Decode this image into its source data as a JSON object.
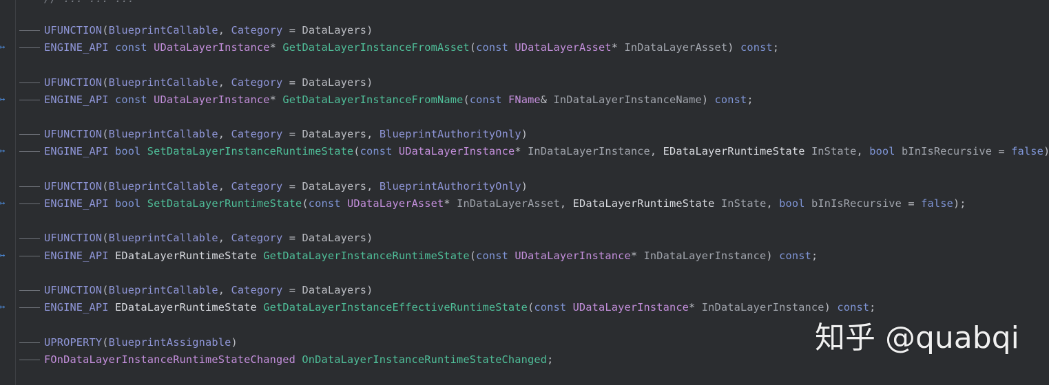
{
  "editor": {
    "top_partial_line": "// ... ... ...",
    "lines": [
      {
        "indent": true,
        "impl_icon": false,
        "tokens": [
          {
            "t": "UFUNCTION",
            "c": "macro"
          },
          {
            "t": "(",
            "c": "punct"
          },
          {
            "t": "BlueprintCallable",
            "c": "macro"
          },
          {
            "t": ", ",
            "c": "punct"
          },
          {
            "t": "Category",
            "c": "macro"
          },
          {
            "t": " = ",
            "c": "punct"
          },
          {
            "t": "DataLayers",
            "c": "ident"
          },
          {
            "t": ")",
            "c": "punct"
          }
        ]
      },
      {
        "indent": true,
        "impl_icon": true,
        "tokens": [
          {
            "t": "ENGINE_API ",
            "c": "macro"
          },
          {
            "t": "const ",
            "c": "kw"
          },
          {
            "t": "UDataLayerInstance",
            "c": "type"
          },
          {
            "t": "* ",
            "c": "punct"
          },
          {
            "t": "GetDataLayerInstanceFromAsset",
            "c": "func"
          },
          {
            "t": "(",
            "c": "punct"
          },
          {
            "t": "const ",
            "c": "kw"
          },
          {
            "t": "UDataLayerAsset",
            "c": "type"
          },
          {
            "t": "* ",
            "c": "punct"
          },
          {
            "t": "InDataLayerAsset",
            "c": "param"
          },
          {
            "t": ") ",
            "c": "punct"
          },
          {
            "t": "const",
            "c": "kw"
          },
          {
            "t": ";",
            "c": "punct"
          }
        ]
      },
      {
        "blank": true
      },
      {
        "indent": true,
        "impl_icon": false,
        "tokens": [
          {
            "t": "UFUNCTION",
            "c": "macro"
          },
          {
            "t": "(",
            "c": "punct"
          },
          {
            "t": "BlueprintCallable",
            "c": "macro"
          },
          {
            "t": ", ",
            "c": "punct"
          },
          {
            "t": "Category",
            "c": "macro"
          },
          {
            "t": " = ",
            "c": "punct"
          },
          {
            "t": "DataLayers",
            "c": "ident"
          },
          {
            "t": ")",
            "c": "punct"
          }
        ]
      },
      {
        "indent": true,
        "impl_icon": true,
        "tokens": [
          {
            "t": "ENGINE_API ",
            "c": "macro"
          },
          {
            "t": "const ",
            "c": "kw"
          },
          {
            "t": "UDataLayerInstance",
            "c": "type"
          },
          {
            "t": "* ",
            "c": "punct"
          },
          {
            "t": "GetDataLayerInstanceFromName",
            "c": "func"
          },
          {
            "t": "(",
            "c": "punct"
          },
          {
            "t": "const ",
            "c": "kw"
          },
          {
            "t": "FName",
            "c": "type"
          },
          {
            "t": "& ",
            "c": "punct"
          },
          {
            "t": "InDataLayerInstanceName",
            "c": "param"
          },
          {
            "t": ") ",
            "c": "punct"
          },
          {
            "t": "const",
            "c": "kw"
          },
          {
            "t": ";",
            "c": "punct"
          }
        ]
      },
      {
        "blank": true
      },
      {
        "indent": true,
        "impl_icon": false,
        "tokens": [
          {
            "t": "UFUNCTION",
            "c": "macro"
          },
          {
            "t": "(",
            "c": "punct"
          },
          {
            "t": "BlueprintCallable",
            "c": "macro"
          },
          {
            "t": ", ",
            "c": "punct"
          },
          {
            "t": "Category",
            "c": "macro"
          },
          {
            "t": " = ",
            "c": "punct"
          },
          {
            "t": "DataLayers",
            "c": "ident"
          },
          {
            "t": ", ",
            "c": "punct"
          },
          {
            "t": "BlueprintAuthorityOnly",
            "c": "macro"
          },
          {
            "t": ")",
            "c": "punct"
          }
        ]
      },
      {
        "indent": true,
        "impl_icon": true,
        "tokens": [
          {
            "t": "ENGINE_API ",
            "c": "macro"
          },
          {
            "t": "bool ",
            "c": "kw"
          },
          {
            "t": "SetDataLayerInstanceRuntimeState",
            "c": "func"
          },
          {
            "t": "(",
            "c": "punct"
          },
          {
            "t": "const ",
            "c": "kw"
          },
          {
            "t": "UDataLayerInstance",
            "c": "type"
          },
          {
            "t": "* ",
            "c": "punct"
          },
          {
            "t": "InDataLayerInstance",
            "c": "param"
          },
          {
            "t": ", ",
            "c": "punct"
          },
          {
            "t": "EDataLayerRuntimeState",
            "c": "enum"
          },
          {
            "t": " ",
            "c": "punct"
          },
          {
            "t": "InState",
            "c": "param"
          },
          {
            "t": ", ",
            "c": "punct"
          },
          {
            "t": "bool ",
            "c": "kw"
          },
          {
            "t": "bInIsRecursive",
            "c": "param"
          },
          {
            "t": " = ",
            "c": "punct"
          },
          {
            "t": "false",
            "c": "kw"
          },
          {
            "t": ");",
            "c": "punct"
          }
        ]
      },
      {
        "blank": true
      },
      {
        "indent": true,
        "impl_icon": false,
        "tokens": [
          {
            "t": "UFUNCTION",
            "c": "macro"
          },
          {
            "t": "(",
            "c": "punct"
          },
          {
            "t": "BlueprintCallable",
            "c": "macro"
          },
          {
            "t": ", ",
            "c": "punct"
          },
          {
            "t": "Category",
            "c": "macro"
          },
          {
            "t": " = ",
            "c": "punct"
          },
          {
            "t": "DataLayers",
            "c": "ident"
          },
          {
            "t": ", ",
            "c": "punct"
          },
          {
            "t": "BlueprintAuthorityOnly",
            "c": "macro"
          },
          {
            "t": ")",
            "c": "punct"
          }
        ]
      },
      {
        "indent": true,
        "impl_icon": true,
        "tokens": [
          {
            "t": "ENGINE_API ",
            "c": "macro"
          },
          {
            "t": "bool ",
            "c": "kw"
          },
          {
            "t": "SetDataLayerRuntimeState",
            "c": "func"
          },
          {
            "t": "(",
            "c": "punct"
          },
          {
            "t": "const ",
            "c": "kw"
          },
          {
            "t": "UDataLayerAsset",
            "c": "type"
          },
          {
            "t": "* ",
            "c": "punct"
          },
          {
            "t": "InDataLayerAsset",
            "c": "param"
          },
          {
            "t": ", ",
            "c": "punct"
          },
          {
            "t": "EDataLayerRuntimeState",
            "c": "enum"
          },
          {
            "t": " ",
            "c": "punct"
          },
          {
            "t": "InState",
            "c": "param"
          },
          {
            "t": ", ",
            "c": "punct"
          },
          {
            "t": "bool ",
            "c": "kw"
          },
          {
            "t": "bInIsRecursive",
            "c": "param"
          },
          {
            "t": " = ",
            "c": "punct"
          },
          {
            "t": "false",
            "c": "kw"
          },
          {
            "t": ");",
            "c": "punct"
          }
        ]
      },
      {
        "blank": true
      },
      {
        "indent": true,
        "impl_icon": false,
        "tokens": [
          {
            "t": "UFUNCTION",
            "c": "macro"
          },
          {
            "t": "(",
            "c": "punct"
          },
          {
            "t": "BlueprintCallable",
            "c": "macro"
          },
          {
            "t": ", ",
            "c": "punct"
          },
          {
            "t": "Category",
            "c": "macro"
          },
          {
            "t": " = ",
            "c": "punct"
          },
          {
            "t": "DataLayers",
            "c": "ident"
          },
          {
            "t": ")",
            "c": "punct"
          }
        ]
      },
      {
        "indent": true,
        "impl_icon": true,
        "tokens": [
          {
            "t": "ENGINE_API ",
            "c": "macro"
          },
          {
            "t": "EDataLayerRuntimeState",
            "c": "enum"
          },
          {
            "t": " ",
            "c": "punct"
          },
          {
            "t": "GetDataLayerInstanceRuntimeState",
            "c": "func"
          },
          {
            "t": "(",
            "c": "punct"
          },
          {
            "t": "const ",
            "c": "kw"
          },
          {
            "t": "UDataLayerInstance",
            "c": "type"
          },
          {
            "t": "* ",
            "c": "punct"
          },
          {
            "t": "InDataLayerInstance",
            "c": "param"
          },
          {
            "t": ") ",
            "c": "punct"
          },
          {
            "t": "const",
            "c": "kw"
          },
          {
            "t": ";",
            "c": "punct"
          }
        ]
      },
      {
        "blank": true
      },
      {
        "indent": true,
        "impl_icon": false,
        "tokens": [
          {
            "t": "UFUNCTION",
            "c": "macro"
          },
          {
            "t": "(",
            "c": "punct"
          },
          {
            "t": "BlueprintCallable",
            "c": "macro"
          },
          {
            "t": ", ",
            "c": "punct"
          },
          {
            "t": "Category",
            "c": "macro"
          },
          {
            "t": " = ",
            "c": "punct"
          },
          {
            "t": "DataLayers",
            "c": "ident"
          },
          {
            "t": ")",
            "c": "punct"
          }
        ]
      },
      {
        "indent": true,
        "impl_icon": true,
        "tokens": [
          {
            "t": "ENGINE_API ",
            "c": "macro"
          },
          {
            "t": "EDataLayerRuntimeState",
            "c": "enum"
          },
          {
            "t": " ",
            "c": "punct"
          },
          {
            "t": "GetDataLayerInstanceEffectiveRuntimeState",
            "c": "func"
          },
          {
            "t": "(",
            "c": "punct"
          },
          {
            "t": "const ",
            "c": "kw"
          },
          {
            "t": "UDataLayerInstance",
            "c": "type"
          },
          {
            "t": "* ",
            "c": "punct"
          },
          {
            "t": "InDataLayerInstance",
            "c": "param"
          },
          {
            "t": ") ",
            "c": "punct"
          },
          {
            "t": "const",
            "c": "kw"
          },
          {
            "t": ";",
            "c": "punct"
          }
        ]
      },
      {
        "blank": true
      },
      {
        "indent": true,
        "impl_icon": false,
        "tokens": [
          {
            "t": "UPROPERTY",
            "c": "macro"
          },
          {
            "t": "(",
            "c": "punct"
          },
          {
            "t": "BlueprintAssignable",
            "c": "macro"
          },
          {
            "t": ")",
            "c": "punct"
          }
        ]
      },
      {
        "indent": true,
        "impl_icon": false,
        "tokens": [
          {
            "t": "FOnDataLayerInstanceRuntimeStateChanged",
            "c": "type"
          },
          {
            "t": " ",
            "c": "punct"
          },
          {
            "t": "OnDataLayerInstanceRuntimeStateChanged",
            "c": "func"
          },
          {
            "t": ";",
            "c": "punct"
          }
        ]
      }
    ]
  },
  "watermark": {
    "text": "知乎 @quabqi"
  },
  "colors": {
    "background": "#2b2d30",
    "macro": "#8f96d8",
    "keyword": "#7f95d6",
    "type": "#c48fdc",
    "function": "#4fbf99",
    "identifier": "#bcbec4"
  },
  "icons": {
    "impl_marker": "implementation-gutter-icon"
  }
}
